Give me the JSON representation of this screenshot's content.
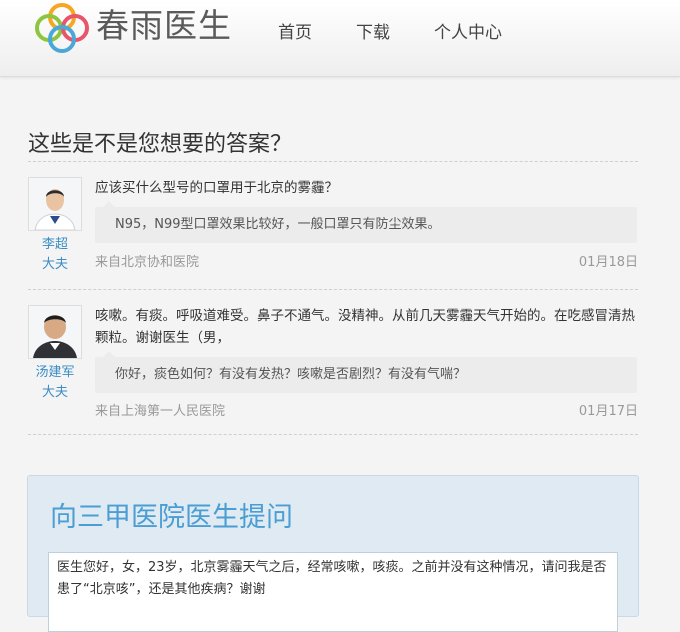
{
  "header": {
    "logo_text": "春雨医生",
    "nav": {
      "home": "首页",
      "download": "下载",
      "personal_center": "个人中心"
    }
  },
  "main": {
    "section_title": "这些是不是您想要的答案？",
    "answers": [
      {
        "doctor_name": "李超",
        "doctor_title": "大夫",
        "question": "应该买什么型号的口罩用于北京的雾霾？",
        "answer": "N95，N99型口罩效果比较好，一般口罩只有防尘效果。",
        "source": "来自北京协和医院",
        "date": "01月18日"
      },
      {
        "doctor_name": "汤建军",
        "doctor_title": "大夫",
        "question": "咳嗽。有痰。呼吸道难受。鼻子不通气。没精神。从前几天雾霾天气开始的。在吃感冒清热颗粒。谢谢医生（男，",
        "answer": "你好，痰色如何？有没有发热？咳嗽是否剧烈？有没有气喘？",
        "source": "来自上海第一人民医院",
        "date": "01月17日"
      }
    ]
  },
  "ask": {
    "title": "向三甲医院医生提问",
    "input_value": "医生您好，女，23岁，北京雾霾天气之后，经常咳嗽，咳痰。之前并没有这种情况，请问我是否患了“北京咳”，还是其他疾病？谢谢"
  },
  "colors": {
    "accent_blue": "#3a8cc4",
    "ask_title": "#4a9ed3",
    "ask_panel_bg": "#dfeaf3",
    "logo_ring_green": "#8cc63f",
    "logo_ring_red": "#e8556a",
    "logo_ring_blue": "#4aa8d8",
    "logo_ring_orange": "#f5a623"
  }
}
